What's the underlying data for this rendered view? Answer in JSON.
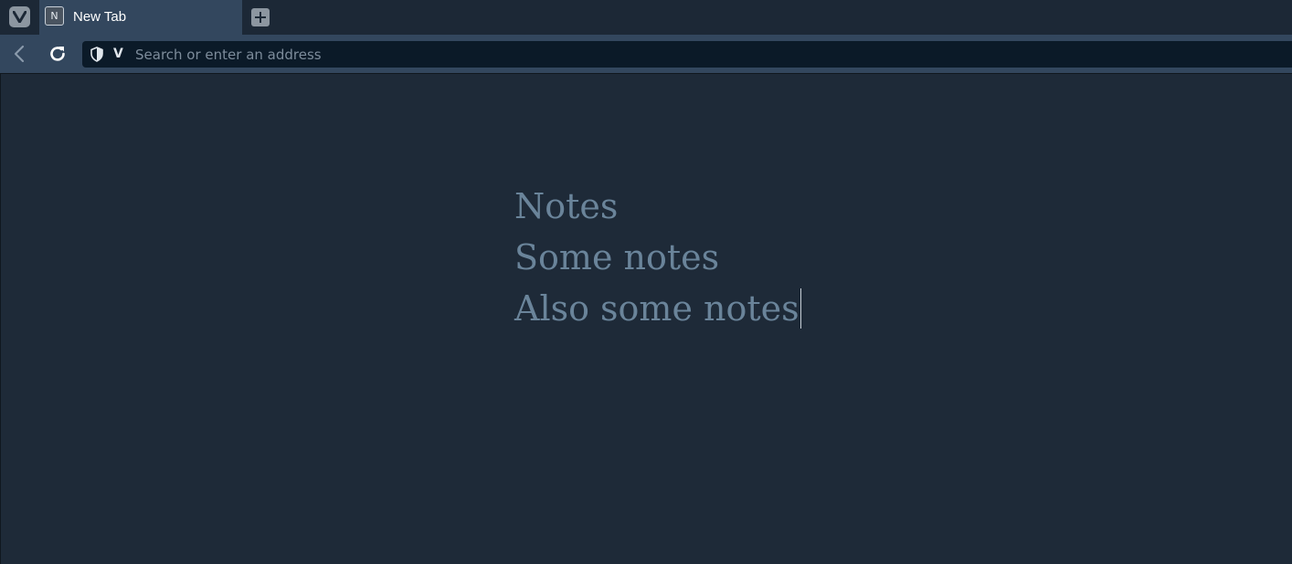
{
  "tabbar": {
    "menu_icon": "vivaldi-logo-icon",
    "tabs": [
      {
        "title": "New Tab",
        "favicon_letter": "N",
        "active": true
      }
    ],
    "new_tab_icon": "plus-icon"
  },
  "toolbar": {
    "back_icon": "chevron-left-icon",
    "reload_icon": "reload-icon",
    "address": {
      "security_icon": "shield-icon",
      "engine_badge": "V",
      "value": "",
      "placeholder": "Search or enter an address"
    }
  },
  "page": {
    "lines": [
      "Notes",
      "Some notes",
      "Also some notes"
    ]
  },
  "colors": {
    "tabbar_bg": "#1c2836",
    "active_tab_bg": "#33475e",
    "address_bg": "#0b1a28",
    "page_bg": "#1e2a38",
    "notes_text": "#6a849a"
  }
}
